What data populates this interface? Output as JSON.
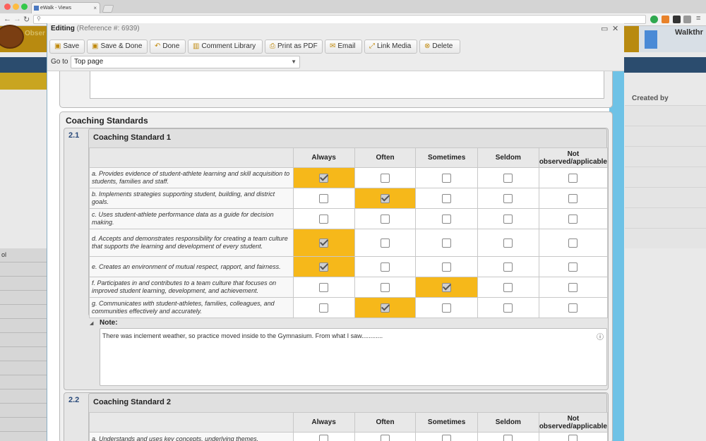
{
  "browser": {
    "tab_title": "eWalk - Views",
    "tab_close": "×"
  },
  "app_bg": {
    "walkthrough_label": "Walkthr",
    "created_by_header": "Created by",
    "obs_label": "Obser",
    "left_row_label": "ol"
  },
  "modal": {
    "title": "Editing",
    "reference": "(Reference #: 6939)",
    "restore_glyph": "▭",
    "close_glyph": "✕",
    "toolbar": {
      "save": "Save",
      "save_done": "Save & Done",
      "done": "Done",
      "comment_library": "Comment Library",
      "print_pdf": "Print as PDF",
      "email": "Email",
      "link_media": "Link Media",
      "delete": "Delete"
    },
    "goto_label": "Go to",
    "goto_value": "Top page"
  },
  "section": {
    "title": "Coaching Standards",
    "columns": [
      "Always",
      "Often",
      "Sometimes",
      "Seldom",
      "Not observed/applicable"
    ],
    "standards": [
      {
        "number": "2.1",
        "title": "Coaching Standard 1",
        "criteria": [
          {
            "text": "a. Provides evidence of student-athlete learning and skill acquisition to students, families and staff.",
            "selected": 0
          },
          {
            "text": "b. Implements strategies supporting student, building, and district goals.",
            "selected": 1
          },
          {
            "text": "c. Uses student-athlete performance data as a guide for decision making.",
            "selected": -1
          },
          {
            "text": "d. Accepts and demonstrates responsibility for creating a team culture that supports the learning and development of every student.",
            "selected": 0
          },
          {
            "text": "e. Creates an environment of mutual respect, rapport, and fairness.",
            "selected": 0
          },
          {
            "text": "f. Participates in and contributes to a team culture that focuses on improved student learning, development, and achievement.",
            "selected": 2
          },
          {
            "text": "g. Communicates with student-athletes, families, colleagues, and communities effectively and accurately.",
            "selected": 1
          }
        ],
        "note_label": "Note:",
        "note_text": "There was inclement weather, so practice moved inside to the Gymnasium. From what I saw............"
      },
      {
        "number": "2.2",
        "title": "Coaching Standard 2",
        "criteria": [
          {
            "text": "a. Understands and uses key concepts, underlying themes,",
            "selected": -1
          }
        ]
      }
    ]
  },
  "colors": {
    "selected_cell": "#f6b81a",
    "modal_edge": "#6ec2e6"
  }
}
